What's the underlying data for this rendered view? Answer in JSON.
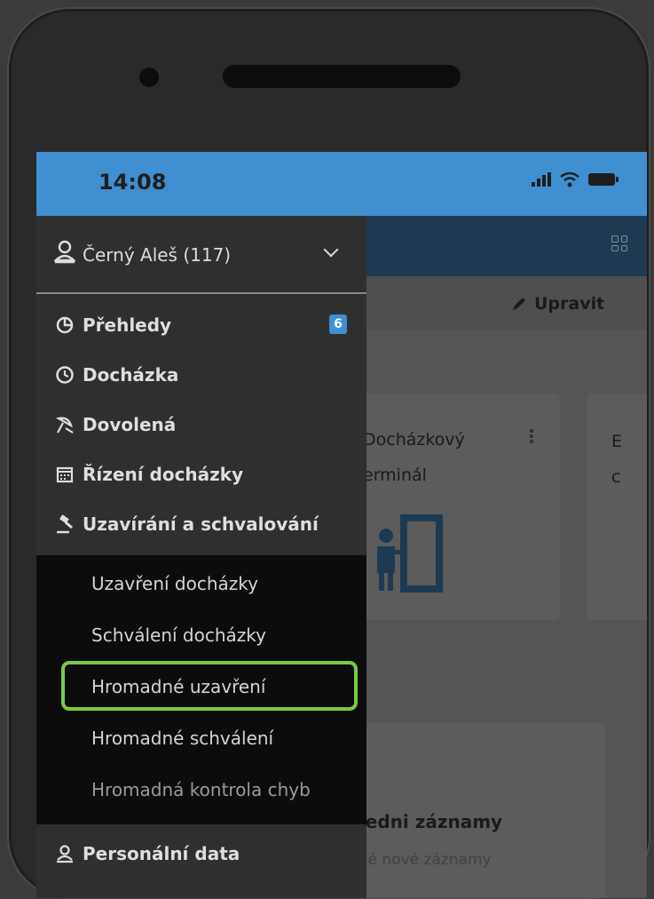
{
  "status_bar": {
    "time": "14:08"
  },
  "app": {
    "edit_label": "Upravit",
    "card1": {
      "title_line1": "Docházkový",
      "title_line2": "erminál",
      "menu": "⋮"
    },
    "card2": {
      "line1": "E",
      "line2": "c"
    },
    "card3": {
      "title": "sledni záznamy",
      "subtitle": "dné nové záznamy"
    }
  },
  "drawer": {
    "user": {
      "name": "Černý Aleš (117)"
    },
    "items": [
      {
        "label": "Přehledy",
        "icon": "pie-chart-icon",
        "badge": "6"
      },
      {
        "label": "Docházka",
        "icon": "clock-icon"
      },
      {
        "label": "Dovolená",
        "icon": "beach-umbrella-icon"
      },
      {
        "label": "Řízení docházky",
        "icon": "calendar-icon"
      },
      {
        "label": "Uzavírání a schvalování",
        "icon": "gavel-icon"
      }
    ],
    "submenu": [
      {
        "label": "Uzavření docházky"
      },
      {
        "label": "Schválení docházky"
      },
      {
        "label": "Hromadné uzavření"
      },
      {
        "label": "Hromadné schválení"
      },
      {
        "label": "Hromadná kontrola chyb"
      }
    ],
    "bottom_item": {
      "label": "Personální data",
      "icon": "person-icon"
    }
  },
  "colors": {
    "accent": "#3f8fd1",
    "highlight": "#7ac943",
    "header": "#1d3a52"
  }
}
